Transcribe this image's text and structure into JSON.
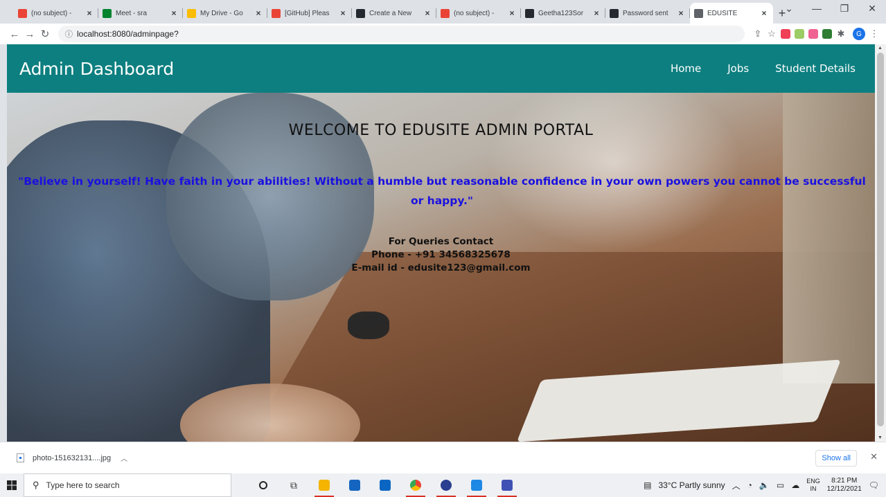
{
  "browser": {
    "tabs": [
      {
        "title": "(no subject) -",
        "icon": "gmail-icon",
        "color": "#ea4335"
      },
      {
        "title": "Meet - sra",
        "icon": "meet-icon",
        "color": "#00832d"
      },
      {
        "title": "My Drive - Go",
        "icon": "drive-icon",
        "color": "#fbbc04"
      },
      {
        "title": "[GitHub] Pleas",
        "icon": "gmail-icon",
        "color": "#ea4335"
      },
      {
        "title": "Create a New",
        "icon": "github-icon",
        "color": "#24292f"
      },
      {
        "title": "(no subject) -",
        "icon": "gmail-icon",
        "color": "#ea4335"
      },
      {
        "title": "Geetha123Sor",
        "icon": "github-icon",
        "color": "#24292f"
      },
      {
        "title": "Password sent",
        "icon": "github-icon",
        "color": "#24292f"
      },
      {
        "title": "EDUSITE",
        "icon": "globe-icon",
        "color": "#5f6368"
      }
    ],
    "url": "localhost:8080/adminpage?"
  },
  "page": {
    "brand": "Admin Dashboard",
    "nav": [
      "Home",
      "Jobs",
      "Student Details"
    ],
    "welcome": "WELCOME TO EDUSITE ADMIN PORTAL",
    "quote": "\"Believe in yourself! Have faith in your abilities! Without a humble but reasonable confidence in your own powers you cannot be successful or happy.\"",
    "contact_title": "For Queries Contact",
    "contact_phone": "Phone - +91 34568325678",
    "contact_email": "E-mail id - edusite123@gmail.com",
    "colors": {
      "navbar": "#0e7f80",
      "quote": "#1a10e0"
    }
  },
  "downloads": {
    "file": "photo-151632131....jpg",
    "show_all": "Show all"
  },
  "taskbar": {
    "search_placeholder": "Type here to search",
    "weather": "33°C  Partly sunny",
    "lang1": "ENG",
    "lang2": "IN",
    "time": "8:21 PM",
    "date": "12/12/2021"
  }
}
